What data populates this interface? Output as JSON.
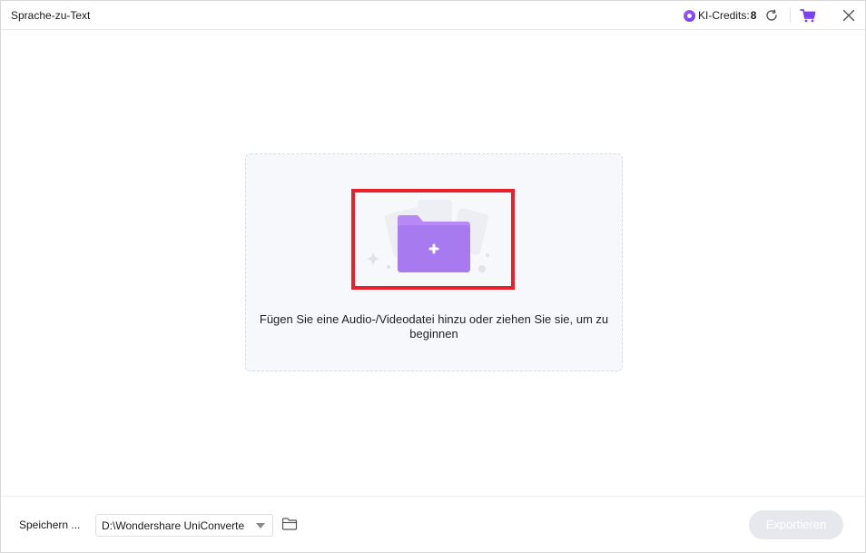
{
  "window": {
    "title": "Sprache-zu-Text"
  },
  "credits": {
    "label": "KI-Credits:",
    "value": "8",
    "icon": "ai-credits-icon"
  },
  "titlebar_icons": {
    "refresh": "refresh-icon",
    "cart": "cart-icon",
    "close": "close-icon"
  },
  "dropzone": {
    "instruction": "Fügen Sie eine Audio-/Videodatei hinzu oder ziehen Sie sie, um zu beginnen",
    "icon": "add-folder-icon"
  },
  "footer": {
    "save_label": "Speichern ...",
    "save_path": "D:\\Wondershare UniConverte",
    "folder_icon": "folder-icon",
    "export_label": "Exportieren",
    "export_enabled": false
  },
  "colors": {
    "accent": "#9b6cf2",
    "highlight": "#e8202a",
    "export_disabled_bg": "#e6e8ee"
  }
}
